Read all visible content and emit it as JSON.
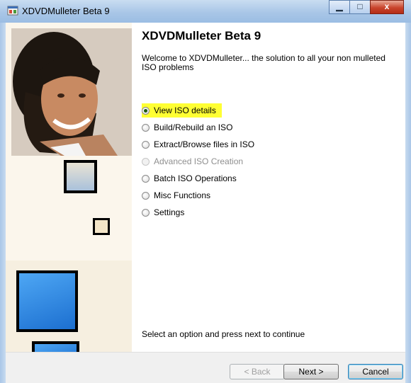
{
  "window": {
    "title": "XDVDMulleter Beta 9",
    "controls": [
      "minimize",
      "maximize",
      "close"
    ]
  },
  "header": {
    "title": "XDVDMulleter Beta 9",
    "welcome": "Welcome to XDVDMulleter... the solution to all your non mulleted ISO problems"
  },
  "options": [
    {
      "label": "View ISO details",
      "selected": true,
      "enabled": true
    },
    {
      "label": "Build/Rebuild an ISO",
      "selected": false,
      "enabled": true
    },
    {
      "label": "Extract/Browse files in ISO",
      "selected": false,
      "enabled": true
    },
    {
      "label": "Advanced ISO Creation",
      "selected": false,
      "enabled": false
    },
    {
      "label": "Batch ISO Operations",
      "selected": false,
      "enabled": true
    },
    {
      "label": "Misc Functions",
      "selected": false,
      "enabled": true
    },
    {
      "label": "Settings",
      "selected": false,
      "enabled": true
    }
  ],
  "hint": "Select an option and press next to continue",
  "buttons": {
    "back": "< Back",
    "next": "Next >",
    "cancel": "Cancel"
  },
  "colors": {
    "highlight": "#ffff33",
    "sidebar": "#fbf6ec",
    "deco_blue": "#2f8ae6",
    "titlebar": "#a9c6e7"
  }
}
